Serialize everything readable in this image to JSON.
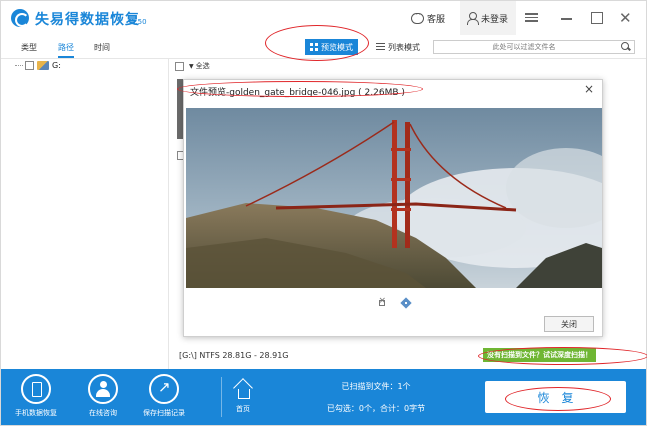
{
  "app": {
    "title": "失易得数据恢复",
    "version": "6.50",
    "service_label": "客服",
    "login_label": "未登录"
  },
  "tabs": [
    {
      "label": "类型",
      "active": false
    },
    {
      "label": "路径",
      "active": true
    },
    {
      "label": "时间",
      "active": false
    }
  ],
  "view_modes": {
    "preview_label": "预览模式",
    "list_label": "列表模式"
  },
  "filter": {
    "placeholder": "此处可以过滤文件名"
  },
  "tree": {
    "root_label": "G:"
  },
  "content": {
    "select_all_label": "全选",
    "status_text": "[G:\\] NTFS 28.81G - 28.91G",
    "deep_scan_label": "没有扫描到文件？试试深度扫描！"
  },
  "preview_dialog": {
    "title": "文件预览-golden_gate_bridge-046.jpg ( 2.26MB )",
    "close_button_label": "关闭",
    "close_icon": "×"
  },
  "bottom_bar": {
    "items": [
      {
        "label": "手机数据恢复",
        "icon": "phone-icon"
      },
      {
        "label": "在线咨询",
        "icon": "consult-icon"
      },
      {
        "label": "保存扫描记录",
        "icon": "save-icon"
      },
      {
        "label": "首页",
        "icon": "home-icon"
      }
    ],
    "scanned_text": "已扫描到文件：1个",
    "selected_text": "已勾选：0个，合计：0字节",
    "recover_label": "恢复"
  },
  "colors": {
    "brand_blue": "#1a86d8",
    "deep_scan_green": "#6fb633",
    "annotation_red": "#e0262a"
  }
}
